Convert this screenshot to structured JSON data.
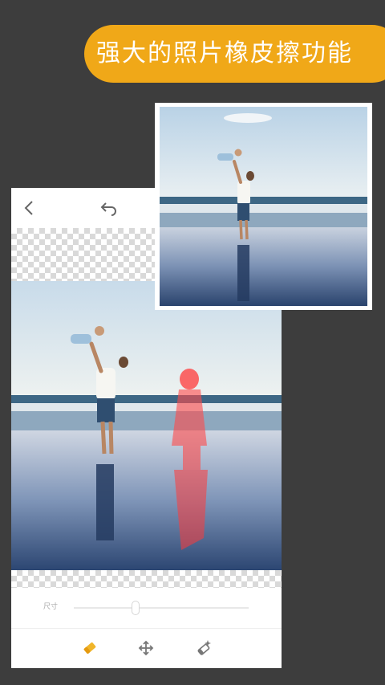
{
  "banner": {
    "text": "强大的照片橡皮擦功能"
  },
  "editor": {
    "slider_label": "尺寸",
    "slider_value": 0.35,
    "colors": {
      "accent": "#f0a818",
      "erase_overlay": "#ff3a3a"
    }
  },
  "icons": [
    "back-icon",
    "undo-icon",
    "eraser-icon",
    "move-icon",
    "magic-eraser-icon"
  ]
}
